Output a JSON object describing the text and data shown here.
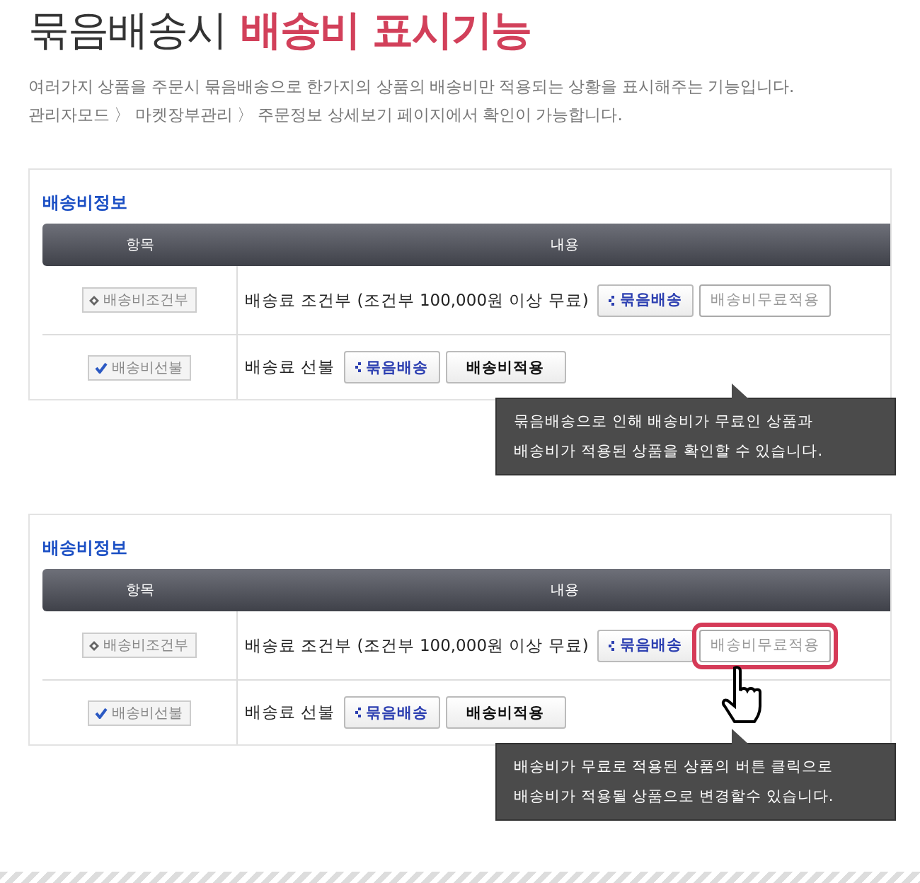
{
  "title": {
    "plain": "묶음배송시",
    "accent": "배송비 표시기능"
  },
  "description": [
    "여러가지 상품을 주문시 묶음배송으로 한가지의 상품의 배송비만 적용되는 상황을 표시해주는 기능입니다.",
    "관리자모드 〉 마켓장부관리 〉 주문정보 상세보기 페이지에서 확인이 가능합니다."
  ],
  "panels": [
    {
      "heading": "배송비정보",
      "columns": [
        "항목",
        "내용"
      ],
      "rows": [
        {
          "badge": {
            "kind": "condition",
            "label": "배송비조건부"
          },
          "text": "배송료 조건부 (조건부 100,000원 이상 무료)",
          "buttons": [
            {
              "kind": "bundle",
              "label": "묶음배송",
              "highlighted": false
            },
            {
              "kind": "free",
              "label": "배송비무료적용",
              "highlighted": false
            }
          ]
        },
        {
          "badge": {
            "kind": "prepaid",
            "label": "배송비선불"
          },
          "text": "배송료 선불",
          "buttons": [
            {
              "kind": "bundle",
              "label": "묶음배송",
              "highlighted": false
            },
            {
              "kind": "apply",
              "label": "배송비적용",
              "highlighted": false
            }
          ]
        }
      ],
      "cursor": false,
      "tooltip": [
        "묶음배송으로 인해 배송비가 무료인 상품과",
        "배송비가 적용된 상품을 확인할 수 있습니다."
      ]
    },
    {
      "heading": "배송비정보",
      "columns": [
        "항목",
        "내용"
      ],
      "rows": [
        {
          "badge": {
            "kind": "condition",
            "label": "배송비조건부"
          },
          "text": "배송료 조건부 (조건부 100,000원 이상 무료)",
          "buttons": [
            {
              "kind": "bundle",
              "label": "묶음배송",
              "highlighted": false
            },
            {
              "kind": "free",
              "label": "배송비무료적용",
              "highlighted": true
            }
          ]
        },
        {
          "badge": {
            "kind": "prepaid",
            "label": "배송비선불"
          },
          "text": "배송료 선불",
          "buttons": [
            {
              "kind": "bundle",
              "label": "묶음배송",
              "highlighted": false
            },
            {
              "kind": "apply",
              "label": "배송비적용",
              "highlighted": false
            }
          ]
        }
      ],
      "cursor": true,
      "tooltip": [
        "배송비가 무료로 적용된 상품의 버튼 클릭으로",
        "배송비가 적용될 상품으로 변경할수 있습니다."
      ]
    }
  ]
}
